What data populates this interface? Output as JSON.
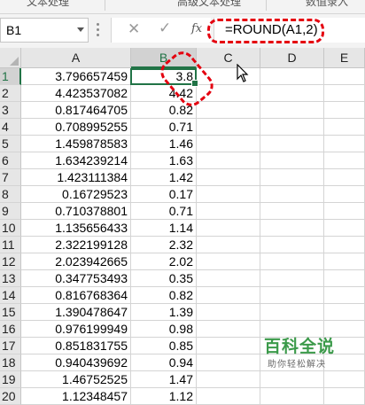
{
  "ribbon": {
    "groups": [
      "文本处理",
      "高级文本处理",
      "数值录入"
    ]
  },
  "name_box": {
    "value": "B1"
  },
  "formula_bar": {
    "cancel_icon": "cancel-x-icon",
    "enter_icon": "check-icon",
    "fx_label": "fx",
    "formula": "=ROUND(A1,2)"
  },
  "columns": [
    "A",
    "B",
    "C",
    "D",
    "E"
  ],
  "rows": [
    {
      "num": "1",
      "a": "3.796657459",
      "b": "3.8"
    },
    {
      "num": "2",
      "a": "4.423537082",
      "b": "4.42"
    },
    {
      "num": "3",
      "a": "0.817464705",
      "b": "0.82"
    },
    {
      "num": "4",
      "a": "0.708995255",
      "b": "0.71"
    },
    {
      "num": "5",
      "a": "1.459878583",
      "b": "1.46"
    },
    {
      "num": "6",
      "a": "1.634239214",
      "b": "1.63"
    },
    {
      "num": "7",
      "a": "1.423111384",
      "b": "1.42"
    },
    {
      "num": "8",
      "a": "0.16729523",
      "b": "0.17"
    },
    {
      "num": "9",
      "a": "0.710378801",
      "b": "0.71"
    },
    {
      "num": "10",
      "a": "1.135656433",
      "b": "1.14"
    },
    {
      "num": "11",
      "a": "2.322199128",
      "b": "2.32"
    },
    {
      "num": "12",
      "a": "2.023942665",
      "b": "2.02"
    },
    {
      "num": "13",
      "a": "0.347753493",
      "b": "0.35"
    },
    {
      "num": "14",
      "a": "0.816768364",
      "b": "0.82"
    },
    {
      "num": "15",
      "a": "1.390478647",
      "b": "1.39"
    },
    {
      "num": "16",
      "a": "0.976199949",
      "b": "0.98"
    },
    {
      "num": "17",
      "a": "0.851831755",
      "b": "0.85"
    },
    {
      "num": "18",
      "a": "0.940439692",
      "b": "0.94"
    },
    {
      "num": "19",
      "a": "1.46752525",
      "b": "1.47"
    },
    {
      "num": "20",
      "a": "1.12348457",
      "b": "1.12"
    }
  ],
  "selected_cell": "B1",
  "watermark": {
    "title": "百科全说",
    "subtitle": "助你轻松解决"
  },
  "colors": {
    "accent": "#217346",
    "annotation": "#e4000f",
    "watermark": "#3b9a4a"
  }
}
